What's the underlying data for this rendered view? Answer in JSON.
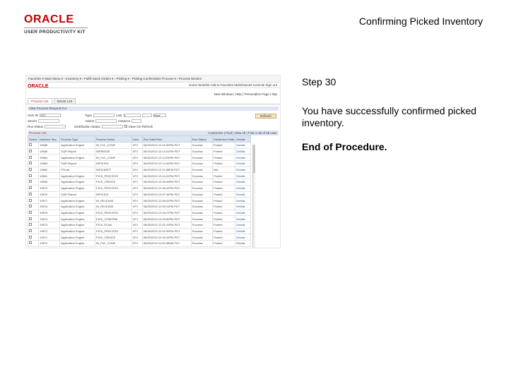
{
  "brand": {
    "logo": "ORACLE",
    "sub": "USER PRODUCTIVITY KIT"
  },
  "page_title": "Confirming Picked Inventory",
  "step": "Step 30",
  "body_text": "You have successfully confirmed picked inventory.",
  "end_text": "End of Procedure.",
  "shot": {
    "breadcrumb": "Favorites ▾  Main Menu ▾  › Inventory ▾ › Fulfill Stock Orders ▾ › Picking ▾ › Picking Confirmation Process ▾ › Process Monitor",
    "nav2": "Home    Worklist    Add to Favorites    Multichannel Console    Sign out",
    "mini_logo": "ORACLE",
    "util": "New Window  |  Help  |  Personalize Page  |  http",
    "tabs": [
      "Process List",
      "Server List"
    ],
    "section_title": "View Process Request For",
    "filters": {
      "user_id_label": "User ID",
      "user_id_value": "VP1",
      "type_label": "Type",
      "last_label": "Last",
      "last_value": "1",
      "days_value": "Days",
      "server_label": "Server",
      "name_label": "Name",
      "instance_label": "Instance",
      "run_status_label": "Run Status",
      "dist_status_label": "Distribution Status",
      "save_on_refresh_label": "Save On Refresh",
      "refresh_button": "Refresh"
    },
    "list_title": "Process List",
    "list_nav": "Customize | Find | View All |    First  1-15 of 25  Last",
    "columns": [
      "Select",
      "Instance Seq.",
      "Process Type",
      "Process Name",
      "User",
      "Run Date/Time",
      "Run Status",
      "Distribution Status",
      "Details"
    ],
    "rows": [
      [
        "",
        "19586",
        "Application Engine",
        "IN_FUL_CONF",
        "VP1",
        "06/25/2013 12:15:30PM PDT",
        "Success",
        "Posted",
        "Details"
      ],
      [
        "",
        "19585",
        "SQR Report",
        "INFREEZE",
        "VP1",
        "06/25/2013 12:14:51PM PDT",
        "Success",
        "Posted",
        "Details"
      ],
      [
        "",
        "19584",
        "Application Engine",
        "IN_FUL_CONF",
        "VP1",
        "06/25/2013 12:14:03PM PDT",
        "Success",
        "Posted",
        "Details"
      ],
      [
        "",
        "19583",
        "SQR Report",
        "INPICK01",
        "VP1",
        "06/25/2013 12:12:40PM PDT",
        "Success",
        "Posted",
        "Details"
      ],
      [
        "",
        "19582",
        "PSJob",
        "INPICKRPT",
        "VP1",
        "06/25/2013 12:11:58PM PDT",
        "Success",
        "N/A",
        "Details"
      ],
      [
        "",
        "19581",
        "Application Engine",
        "PICK_PROCESS",
        "VP1",
        "06/25/2013 12:10:22PM PDT",
        "Success",
        "Posted",
        "Details"
      ],
      [
        "",
        "19580",
        "Application Engine",
        "PICK_CREATE",
        "VP1",
        "06/25/2013 12:09:45PM PDT",
        "Success",
        "Posted",
        "Details"
      ],
      [
        "",
        "19579",
        "Application Engine",
        "PICK_PROCESS",
        "VP1",
        "06/25/2013 12:08:10PM PDT",
        "Success",
        "Posted",
        "Details"
      ],
      [
        "",
        "19578",
        "SQR Report",
        "INPICK01",
        "VP1",
        "06/25/2013 12:07:34PM PDT",
        "Success",
        "Posted",
        "Details"
      ],
      [
        "",
        "19577",
        "Application Engine",
        "IN_RELEASE",
        "VP1",
        "06/25/2013 12:06:02PM PDT",
        "Success",
        "Posted",
        "Details"
      ],
      [
        "",
        "19576",
        "Application Engine",
        "IN_RELEASE",
        "VP1",
        "06/25/2013 12:05:11PM PDT",
        "Success",
        "Posted",
        "Details"
      ],
      [
        "",
        "19575",
        "Application Engine",
        "PICK_PROCESS",
        "VP1",
        "06/25/2013 12:04:27PM PDT",
        "Success",
        "Posted",
        "Details"
      ],
      [
        "",
        "19574",
        "Application Engine",
        "PICK_CONFIRM",
        "VP1",
        "06/25/2013 12:03:50PM PDT",
        "Success",
        "Posted",
        "Details"
      ],
      [
        "",
        "19573",
        "Application Engine",
        "PICK_PLAN",
        "VP1",
        "06/25/2013 12:02:19PM PDT",
        "Success",
        "Posted",
        "Details"
      ],
      [
        "",
        "19572",
        "Application Engine",
        "PICK_PROCESS",
        "VP1",
        "06/25/2013 12:01:05PM PDT",
        "Success",
        "Posted",
        "Details"
      ],
      [
        "",
        "19571",
        "Application Engine",
        "PICK_CREATE",
        "VP1",
        "06/25/2013 12:00:33PM PDT",
        "Success",
        "Posted",
        "Details"
      ],
      [
        "",
        "19570",
        "Application Engine",
        "IN_FUL_CONF",
        "VP1",
        "06/25/2013 11:59:48AM PDT",
        "Success",
        "Posted",
        "Details"
      ]
    ]
  }
}
